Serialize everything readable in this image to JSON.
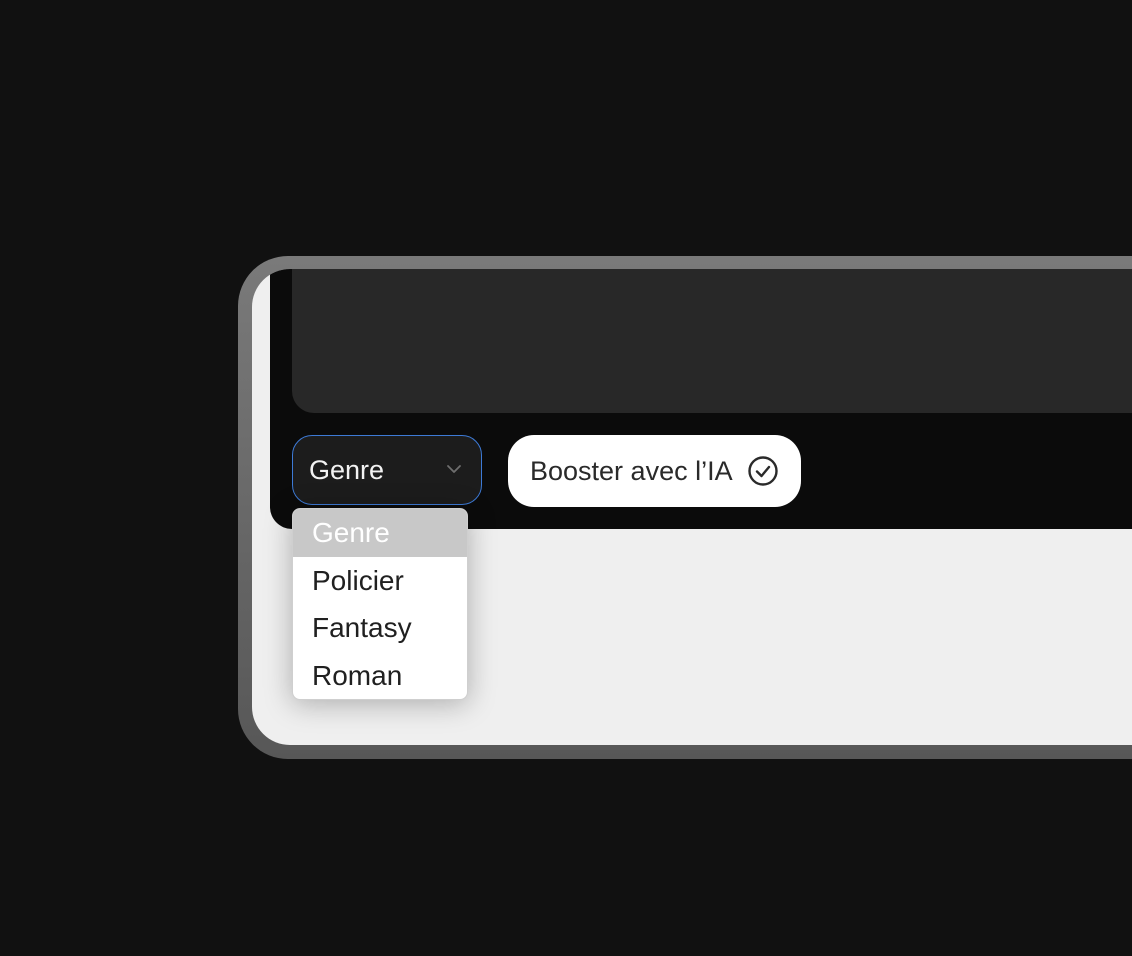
{
  "genre_select": {
    "value": "Genre"
  },
  "boost_button": {
    "label": "Booster avec l’IA"
  },
  "dropdown": {
    "options": [
      "Genre",
      "Policier",
      "Fantasy",
      "Roman"
    ],
    "selected_index": 0
  },
  "colors": {
    "page_background": "#111111",
    "screen_background": "#efefef",
    "panel_background": "#0b0b0b",
    "textarea_background": "#282828",
    "select_focus_border": "#3d7ad6",
    "selected_option_background": "#c8c8c8"
  },
  "icons": [
    "chevron-down-icon",
    "check-circle-icon"
  ]
}
